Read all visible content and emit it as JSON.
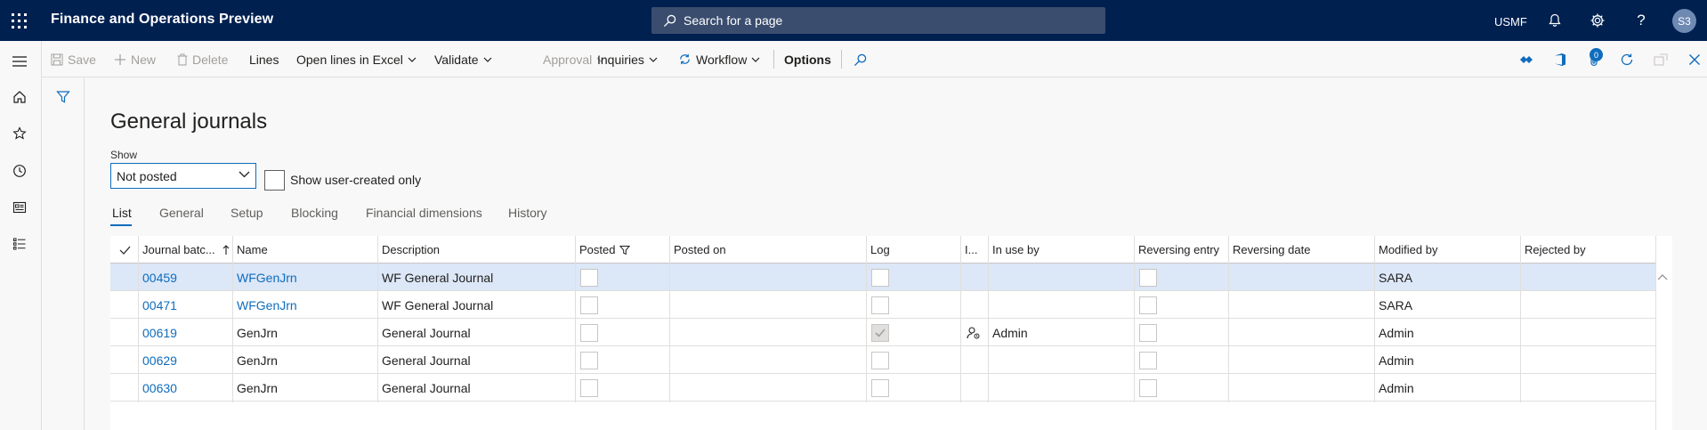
{
  "app": {
    "title": "Finance and Operations Preview",
    "search_placeholder": "Search for a page",
    "company": "USMF",
    "avatar_initials": "S3",
    "attachments_count": "0"
  },
  "actions": {
    "save": "Save",
    "new": "New",
    "delete": "Delete",
    "lines": "Lines",
    "open_excel": "Open lines in Excel",
    "validate": "Validate",
    "approval": "Approval",
    "inquiries": "Inquiries",
    "workflow": "Workflow",
    "options": "Options"
  },
  "page": {
    "title": "General journals",
    "show_label": "Show",
    "show_value": "Not posted",
    "user_created_label": "Show user-created only"
  },
  "tabs": [
    "List",
    "General",
    "Setup",
    "Blocking",
    "Financial dimensions",
    "History"
  ],
  "grid": {
    "headers": {
      "batch": "Journal batc...",
      "name": "Name",
      "description": "Description",
      "posted": "Posted",
      "posted_on": "Posted on",
      "log": "Log",
      "in_use": "I...",
      "in_use_by": "In use by",
      "reversing_entry": "Reversing entry",
      "reversing_date": "Reversing date",
      "modified_by": "Modified by",
      "rejected_by": "Rejected by"
    },
    "rows": [
      {
        "batch": "00459",
        "name": "WFGenJrn",
        "description": "WF General Journal",
        "in_use_by": "",
        "modified_by": "SARA",
        "log_checked": false,
        "in_use": false
      },
      {
        "batch": "00471",
        "name": "WFGenJrn",
        "description": "WF General Journal",
        "in_use_by": "",
        "modified_by": "SARA",
        "log_checked": false,
        "in_use": false
      },
      {
        "batch": "00619",
        "name": "GenJrn",
        "description": "General Journal",
        "in_use_by": "Admin",
        "modified_by": "Admin",
        "log_checked": true,
        "in_use": true
      },
      {
        "batch": "00629",
        "name": "GenJrn",
        "description": "General Journal",
        "in_use_by": "",
        "modified_by": "Admin",
        "log_checked": false,
        "in_use": false
      },
      {
        "batch": "00630",
        "name": "GenJrn",
        "description": "General Journal",
        "in_use_by": "",
        "modified_by": "Admin",
        "log_checked": false,
        "in_use": false
      }
    ]
  }
}
